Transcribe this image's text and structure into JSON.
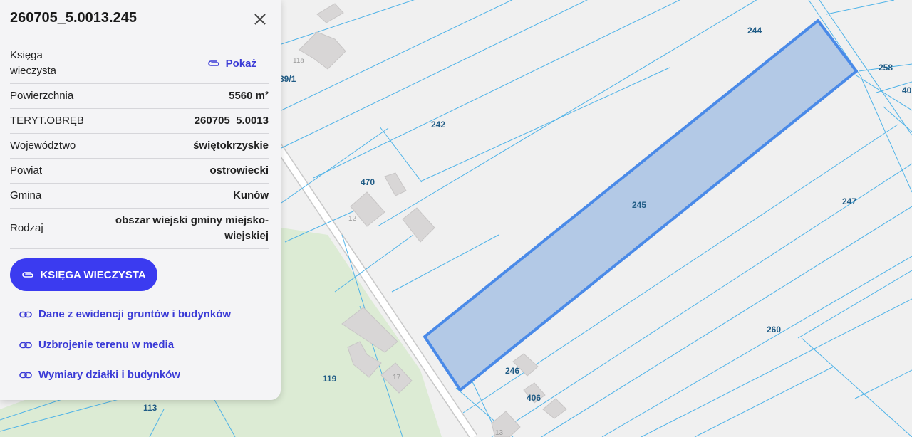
{
  "panel": {
    "title": "260705_5.0013.245",
    "rows": {
      "ksiega_label": "Księga wieczysta",
      "ksiega_link": "Pokaż",
      "powierzchnia_label": "Powierzchnia",
      "powierzchnia_value": "5560 m²",
      "teryt_label": "TERYT.OBRĘB",
      "teryt_value": "260705_5.0013",
      "wojewodztwo_label": "Województwo",
      "wojewodztwo_value": "świętokrzyskie",
      "powiat_label": "Powiat",
      "powiat_value": "ostrowiecki",
      "gmina_label": "Gmina",
      "gmina_value": "Kunów",
      "rodzaj_label": "Rodzaj",
      "rodzaj_value": "obszar wiejski gminy miejsko-wiejskiej"
    },
    "button_label": "KSIĘGA WIECZYSTA",
    "links": [
      "Dane z ewidencji gruntów i budynków",
      "Uzbrojenie terenu w media",
      "Wymiary działki i budynków"
    ]
  },
  "map": {
    "parcel_labels": {
      "p244": "244",
      "p258": "258",
      "p40": "40",
      "p89": "89/1",
      "p242": "242",
      "p470": "470",
      "p245": "245",
      "p247": "247",
      "p260": "260",
      "p246": "246",
      "p406": "406",
      "p119": "119",
      "p113": "113"
    },
    "house_numbers": {
      "h11a": "11a",
      "h12": "12",
      "h17": "17",
      "h13": "13"
    },
    "colors": {
      "parcel_line": "#4fb3e8",
      "selected_fill": "#b3c9e6",
      "selected_stroke": "#4a8ae8",
      "green_area": "#dcebd4",
      "building": "#d8d6d6"
    }
  }
}
